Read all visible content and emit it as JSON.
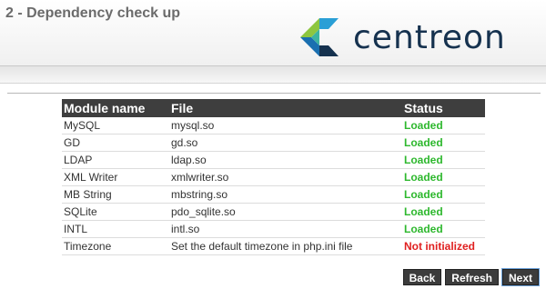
{
  "header": {
    "step_title": "2 - Dependency check up",
    "logo_text": "centreon"
  },
  "table": {
    "headers": {
      "module": "Module name",
      "file": "File",
      "status": "Status"
    },
    "rows": [
      {
        "module": "MySQL",
        "file": "mysql.so",
        "status": "Loaded",
        "ok": true
      },
      {
        "module": "GD",
        "file": "gd.so",
        "status": "Loaded",
        "ok": true
      },
      {
        "module": "LDAP",
        "file": "ldap.so",
        "status": "Loaded",
        "ok": true
      },
      {
        "module": "XML Writer",
        "file": "xmlwriter.so",
        "status": "Loaded",
        "ok": true
      },
      {
        "module": "MB String",
        "file": "mbstring.so",
        "status": "Loaded",
        "ok": true
      },
      {
        "module": "SQLite",
        "file": "pdo_sqlite.so",
        "status": "Loaded",
        "ok": true
      },
      {
        "module": "INTL",
        "file": "intl.so",
        "status": "Loaded",
        "ok": true
      },
      {
        "module": "Timezone",
        "file": "Set the default timezone in php.ini file",
        "status": "Not initialized",
        "ok": false
      }
    ]
  },
  "buttons": {
    "back": "Back",
    "refresh": "Refresh",
    "next": "Next"
  },
  "colors": {
    "loaded": "#2eb82e",
    "not_initialized": "#e02020",
    "logo_text": "#16324f"
  }
}
